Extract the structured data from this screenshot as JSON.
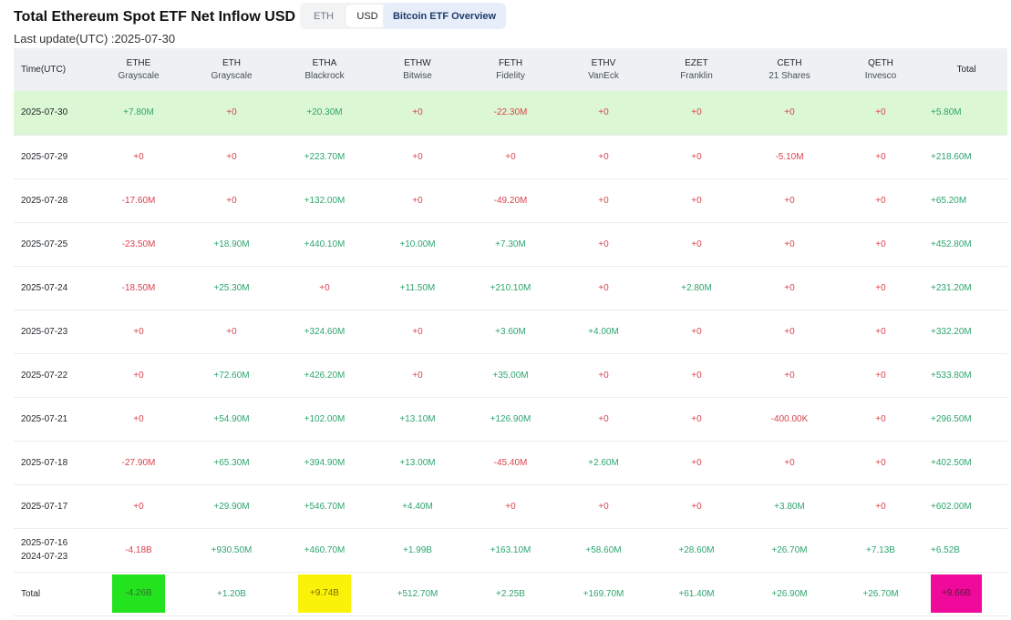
{
  "header": {
    "title": "Total Ethereum Spot ETF Net Inflow USD",
    "segment": [
      "ETH",
      "USD"
    ],
    "active_segment": "USD",
    "btc_button": "Bitcoin ETF Overview",
    "last_update": "Last update(UTC) :2025-07-30"
  },
  "table": {
    "time_header": "Time(UTC)",
    "total_header": "Total",
    "columns": [
      {
        "ticker": "ETHE",
        "issuer": "Grayscale"
      },
      {
        "ticker": "ETH",
        "issuer": "Grayscale"
      },
      {
        "ticker": "ETHA",
        "issuer": "Blackrock"
      },
      {
        "ticker": "ETHW",
        "issuer": "Bitwise"
      },
      {
        "ticker": "FETH",
        "issuer": "Fidelity"
      },
      {
        "ticker": "ETHV",
        "issuer": "VanEck"
      },
      {
        "ticker": "EZET",
        "issuer": "Franklin"
      },
      {
        "ticker": "CETH",
        "issuer": "21 Shares"
      },
      {
        "ticker": "QETH",
        "issuer": "Invesco"
      }
    ],
    "rows": [
      {
        "date": "2025-07-30",
        "values": [
          "+7.80M",
          "+0",
          "+20.30M",
          "+0",
          "-22.30M",
          "+0",
          "+0",
          "+0",
          "+0"
        ],
        "total": "+5.80M"
      },
      {
        "date": "2025-07-29",
        "values": [
          "+0",
          "+0",
          "+223.70M",
          "+0",
          "+0",
          "+0",
          "+0",
          "-5.10M",
          "+0"
        ],
        "total": "+218.60M"
      },
      {
        "date": "2025-07-28",
        "values": [
          "-17.60M",
          "+0",
          "+132.00M",
          "+0",
          "-49.20M",
          "+0",
          "+0",
          "+0",
          "+0"
        ],
        "total": "+65.20M"
      },
      {
        "date": "2025-07-25",
        "values": [
          "-23.50M",
          "+18.90M",
          "+440.10M",
          "+10.00M",
          "+7.30M",
          "+0",
          "+0",
          "+0",
          "+0"
        ],
        "total": "+452.80M"
      },
      {
        "date": "2025-07-24",
        "values": [
          "-18.50M",
          "+25.30M",
          "+0",
          "+11.50M",
          "+210.10M",
          "+0",
          "+2.80M",
          "+0",
          "+0"
        ],
        "total": "+231.20M"
      },
      {
        "date": "2025-07-23",
        "values": [
          "+0",
          "+0",
          "+324.60M",
          "+0",
          "+3.60M",
          "+4.00M",
          "+0",
          "+0",
          "+0"
        ],
        "total": "+332.20M"
      },
      {
        "date": "2025-07-22",
        "values": [
          "+0",
          "+72.60M",
          "+426.20M",
          "+0",
          "+35.00M",
          "+0",
          "+0",
          "+0",
          "+0"
        ],
        "total": "+533.80M"
      },
      {
        "date": "2025-07-21",
        "values": [
          "+0",
          "+54.90M",
          "+102.00M",
          "+13.10M",
          "+126.90M",
          "+0",
          "+0",
          "-400.00K",
          "+0"
        ],
        "total": "+296.50M"
      },
      {
        "date": "2025-07-18",
        "values": [
          "-27.90M",
          "+65.30M",
          "+394.90M",
          "+13.00M",
          "-45.40M",
          "+2.60M",
          "+0",
          "+0",
          "+0"
        ],
        "total": "+402.50M"
      },
      {
        "date": "2025-07-17",
        "values": [
          "+0",
          "+29.90M",
          "+546.70M",
          "+4.40M",
          "+0",
          "+0",
          "+0",
          "+3.80M",
          "+0"
        ],
        "total": "+602.00M"
      }
    ],
    "range_row": {
      "date_from": "2025-07-16",
      "date_to": "2024-07-23",
      "values": [
        "-4.18B",
        "+930.50M",
        "+460.70M",
        "+1.99B",
        "+163.10M",
        "+58.60M",
        "+28.60M",
        "+26.70M",
        "+7.13B"
      ],
      "total": "+6.52B"
    },
    "total_row": {
      "label": "Total",
      "values": [
        "-4.26B",
        "+1.20B",
        "+9.74B",
        "+512.70M",
        "+2.25B",
        "+169.70M",
        "+61.40M",
        "+26.90M",
        "+26.70M"
      ],
      "total": "+9.66B"
    }
  }
}
